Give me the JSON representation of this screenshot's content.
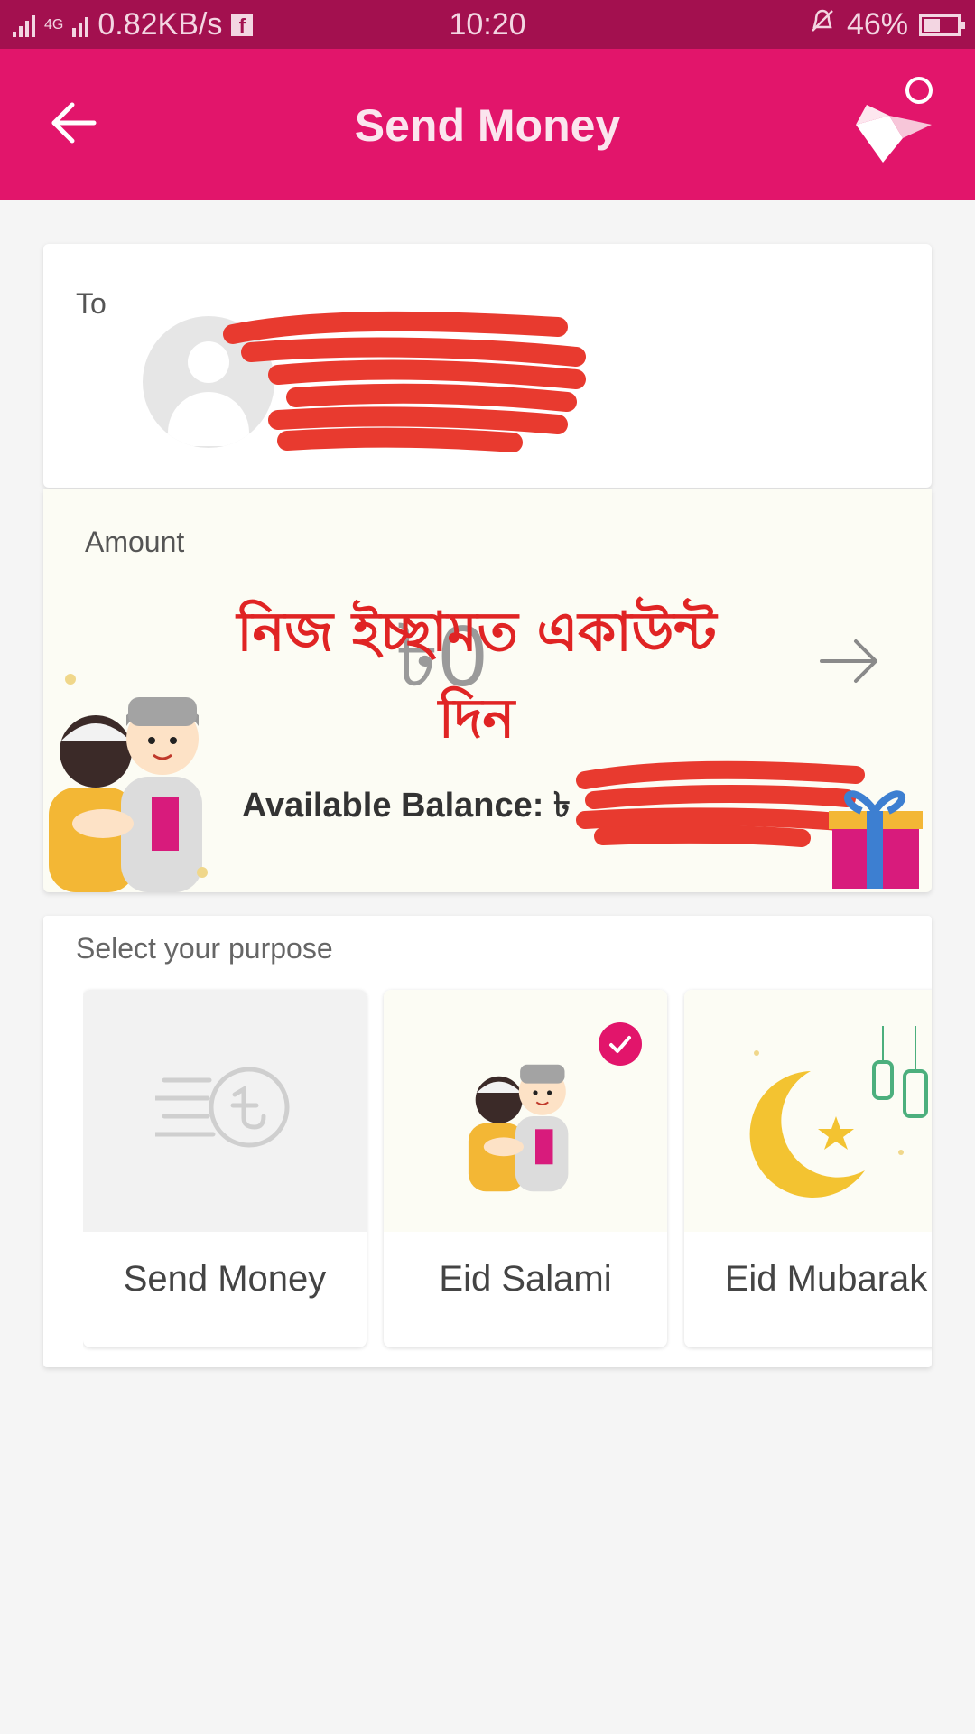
{
  "status_bar": {
    "net_speed": "0.82KB/s",
    "network_type": "4G",
    "time": "10:20",
    "battery": "46%"
  },
  "app_bar": {
    "title": "Send Money"
  },
  "to_section": {
    "label": "To"
  },
  "amount_section": {
    "label": "Amount",
    "value": "৳0",
    "overlay_text_line1": "নিজ ইচ্ছামত একাউন্ট",
    "overlay_text_line2": "দিন",
    "balance_label": "Available Balance: ৳"
  },
  "purpose": {
    "label": "Select your purpose",
    "options": [
      {
        "caption": "Send Money",
        "selected": false
      },
      {
        "caption": "Eid Salami",
        "selected": true
      },
      {
        "caption": "Eid Mubarak",
        "selected": false
      }
    ]
  },
  "colors": {
    "brand": "#e2156b",
    "status_bar": "#a3104f",
    "overlay_text": "#e02424"
  }
}
